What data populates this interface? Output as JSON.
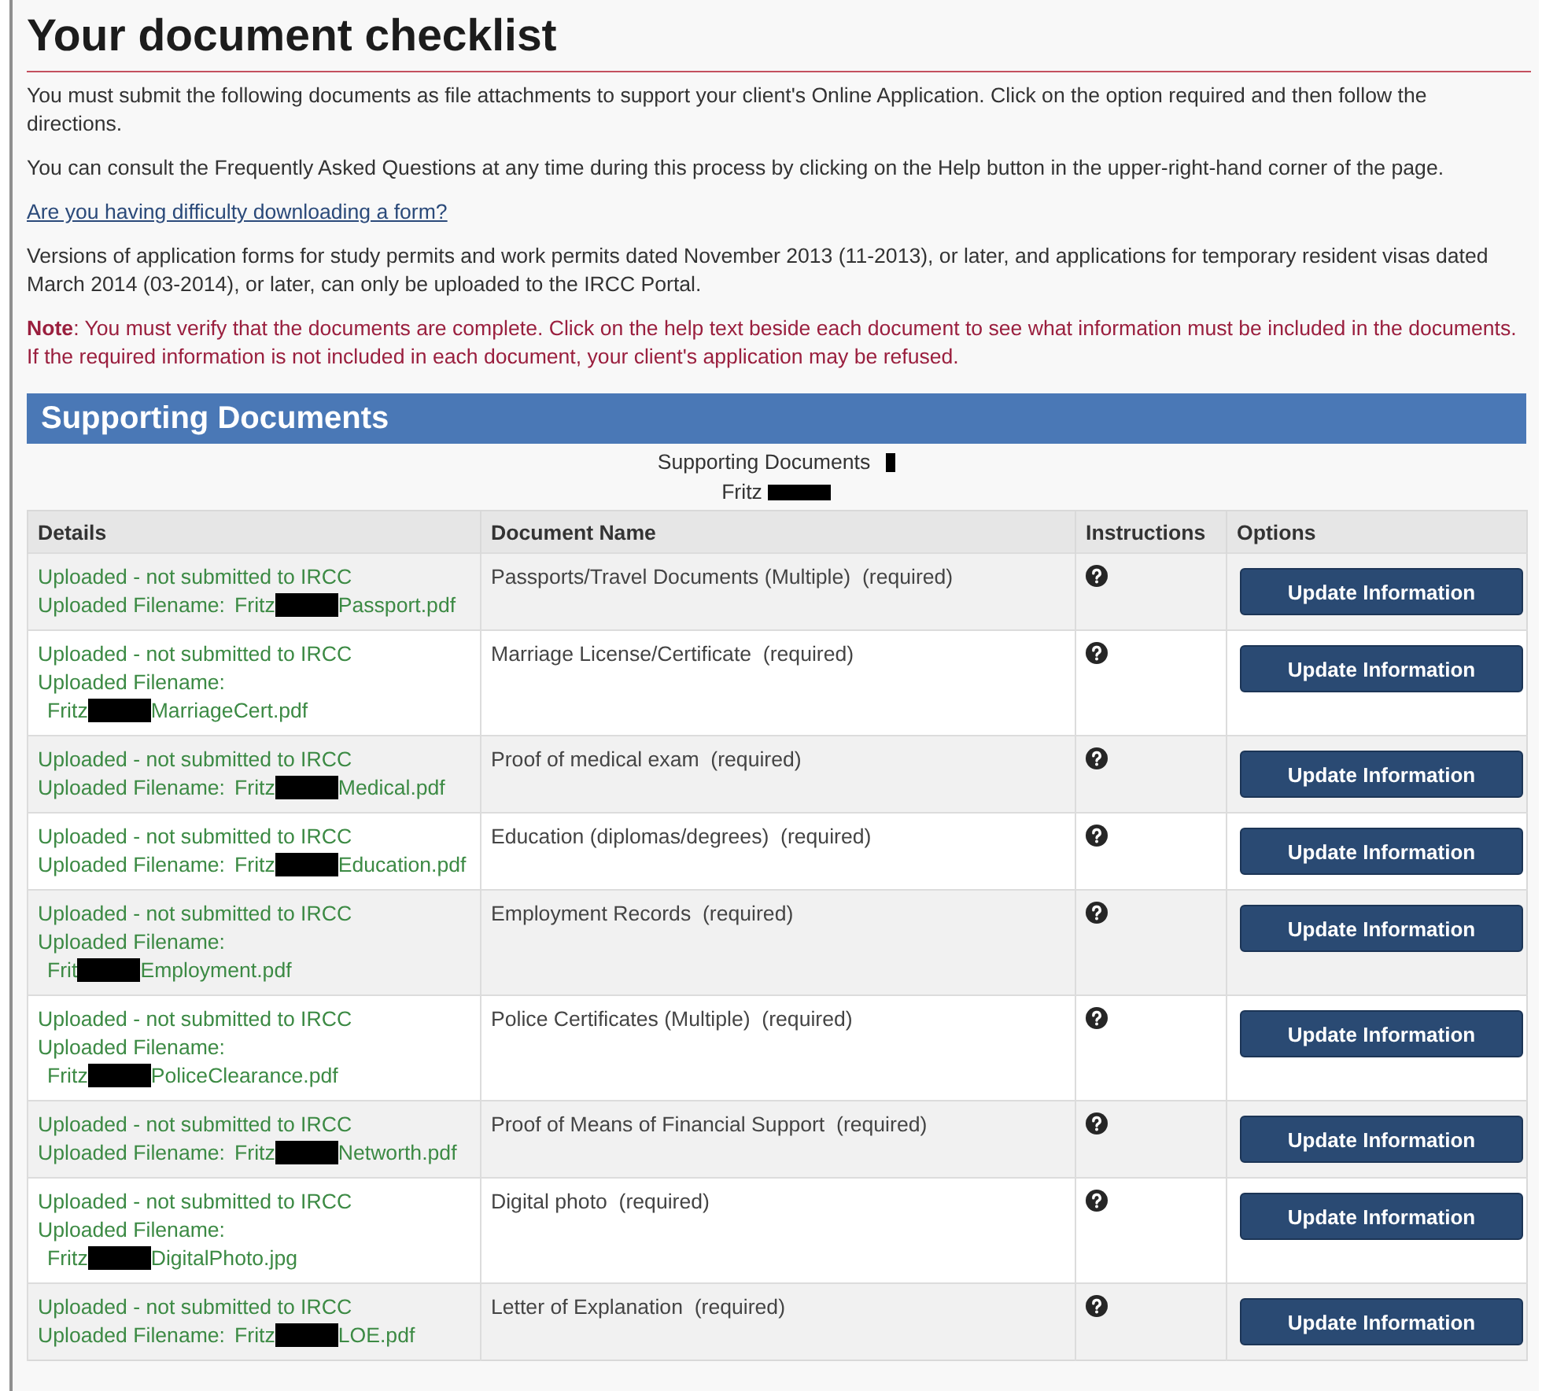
{
  "page": {
    "title": "Your document checklist"
  },
  "intro": [
    {
      "kind": "text",
      "text": "You must submit the following documents as file attachments to support your client's Online Application. Click on the option required and then follow the directions."
    },
    {
      "kind": "text",
      "text": "You can consult the Frequently Asked Questions at any time during this process by clicking on the Help button in the upper-right-hand corner of the page."
    },
    {
      "kind": "link",
      "text": "Are you having difficulty downloading a form?"
    },
    {
      "kind": "text",
      "text": "Versions of application forms for study permits and work permits dated November 2013 (11-2013), or later, and applications for temporary resident visas dated March 2014 (03-2014), or later, can only be uploaded to the IRCC Portal."
    },
    {
      "kind": "note",
      "text": "**Note**: You must verify that the documents are complete. Click on the help text beside each document to see what information must be included in the documents. If the required information is not included in each document, your client's application may be refused."
    }
  ],
  "section": {
    "title": "Supporting Documents",
    "caption": [
      "Supporting Documents",
      "Fritz"
    ]
  },
  "table": {
    "columns": [
      "Details",
      "Document Name",
      "Instructions",
      "Options"
    ],
    "rows": [
      {
        "status": "Uploaded - not submitted to IRCC",
        "filename_label": "Uploaded Filename:",
        "filename_start": "Fritz",
        "filename_end": "Passport.pdf",
        "document": "Passports/Travel Documents (Multiple)  (required)",
        "button": "Update Information"
      },
      {
        "status": "Uploaded - not submitted to IRCC",
        "filename_label": "Uploaded Filename:",
        "filename_start": "Fritz",
        "filename_end": "MarriageCert.pdf",
        "document": "Marriage License/Certificate  (required)",
        "button": "Update Information"
      },
      {
        "status": "Uploaded - not submitted to IRCC",
        "filename_label": "Uploaded Filename:",
        "filename_start": "Fritz",
        "filename_end": "Medical.pdf",
        "document": "Proof of medical exam  (required)",
        "button": "Update Information"
      },
      {
        "status": "Uploaded - not submitted to IRCC",
        "filename_label": "Uploaded Filename:",
        "filename_start": "Fritz",
        "filename_end": "Education.pdf",
        "document": "Education (diplomas/degrees)  (required)",
        "button": "Update Information"
      },
      {
        "status": "Uploaded - not submitted to IRCC",
        "filename_label": "Uploaded Filename:",
        "filename_start": "Frit",
        "filename_end": "Employment.pdf",
        "document": "Employment Records  (required)",
        "button": "Update Information"
      },
      {
        "status": "Uploaded - not submitted to IRCC",
        "filename_label": "Uploaded Filename:",
        "filename_start": "Fritz",
        "filename_end": "PoliceClearance.pdf",
        "document": "Police Certificates (Multiple)  (required)",
        "button": "Update Information"
      },
      {
        "status": "Uploaded - not submitted to IRCC",
        "filename_label": "Uploaded Filename:",
        "filename_start": "Fritz",
        "filename_end": "Networth.pdf",
        "document": "Proof of Means of Financial Support  (required)",
        "button": "Update Information"
      },
      {
        "status": "Uploaded - not submitted to IRCC",
        "filename_label": "Uploaded Filename:",
        "filename_start": "Fritz",
        "filename_end": "DigitalPhoto.jpg",
        "document": "Digital photo  (required)",
        "button": "Update Information"
      },
      {
        "status": "Uploaded - not submitted to IRCC",
        "filename_label": "Uploaded Filename:",
        "filename_start": "Fritz",
        "filename_end": "LOE.pdf",
        "document": "Letter of Explanation  (required)",
        "button": "Update Information"
      }
    ]
  }
}
